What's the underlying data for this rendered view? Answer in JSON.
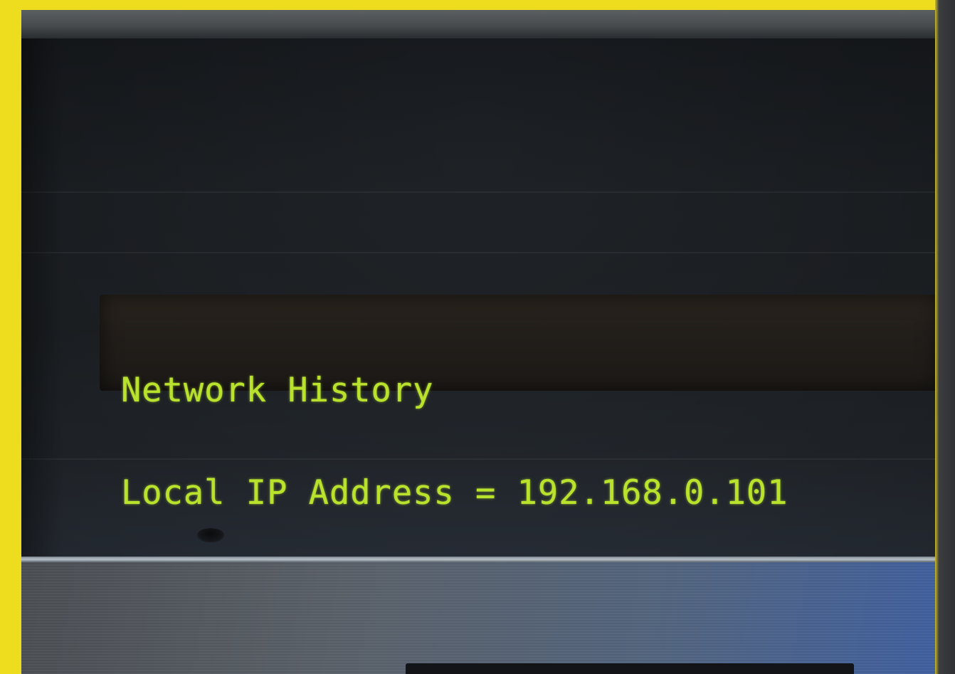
{
  "display": {
    "line1": "Network History",
    "line2": "Local IP Address = 192.168.0.101"
  },
  "colors": {
    "border": "#eedc1e",
    "vfd_text": "#b9e22c",
    "faceplate": "#1f2327",
    "lower_panel": "#52647e"
  }
}
